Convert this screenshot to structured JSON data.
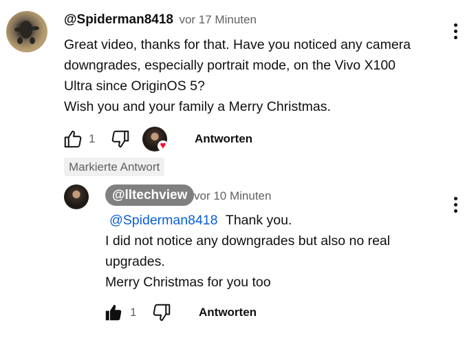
{
  "comment": {
    "author": "@Spiderman8418",
    "time": "vor 17 Minuten",
    "lines": [
      "Great video, thanks for that. Have you noticed any camera",
      "downgrades, especially portrait mode, on the Vivo X100",
      "Ultra since OriginOS 5?",
      "Wish you and your family a Merry Christmas."
    ],
    "likes": "1",
    "reply_label": "Antworten",
    "badge": "Markierte Antwort"
  },
  "reply": {
    "author": "@lltechview",
    "time": "vor 10 Minuten",
    "mention": "@Spiderman8418",
    "first_line_rest": "Thank you.",
    "lines": [
      "I did not notice any downgrades but also no real",
      "upgrades.",
      "Merry Christmas for you too"
    ],
    "likes": "1",
    "reply_label": "Antworten"
  },
  "icons": {
    "like": "thumbs-up-outline-icon",
    "dislike": "thumbs-down-outline-icon",
    "liked": "thumbs-up-filled-icon",
    "more": "more-vertical-icon",
    "heart": "heart-icon"
  },
  "colors": {
    "heart": "#ff0033",
    "mention": "#065fd4",
    "chip_bg": "#808080"
  }
}
